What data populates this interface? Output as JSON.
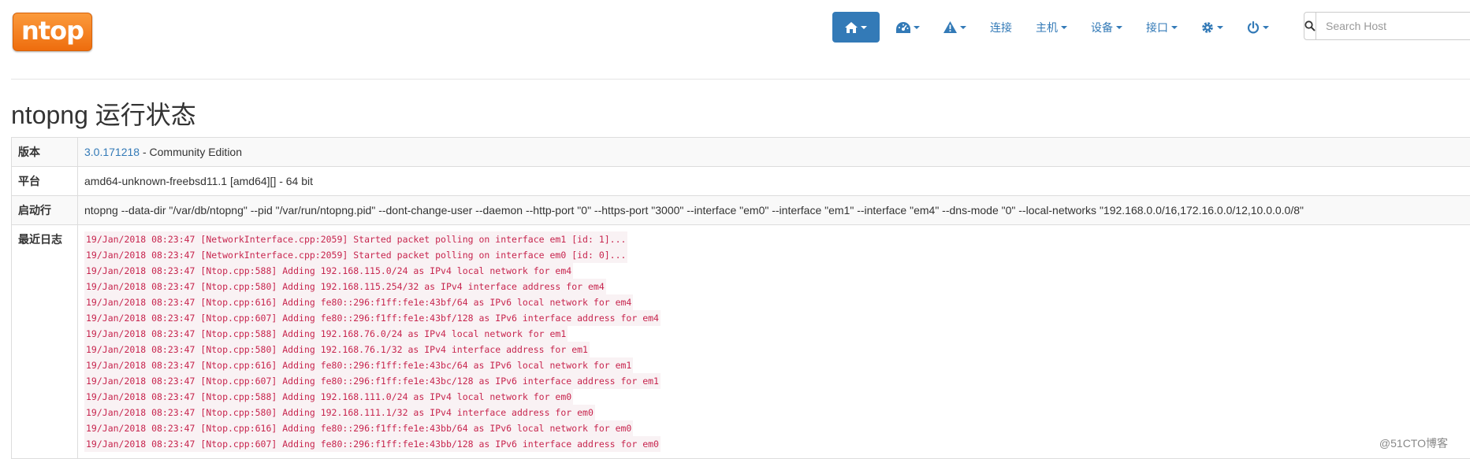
{
  "logo": {
    "text": "ntop"
  },
  "nav": {
    "links": [
      "连接",
      "主机",
      "设备",
      "接口"
    ]
  },
  "search": {
    "placeholder": "Search Host"
  },
  "page": {
    "title": "ntopng 运行状态"
  },
  "status": {
    "version_label": "版本",
    "version_link": "3.0.171218",
    "version_suffix": " - Community Edition",
    "platform_label": "平台",
    "platform_value": "amd64-unknown-freebsd11.1 [amd64][] - 64 bit",
    "startup_label": "启动行",
    "startup_value": "ntopng --data-dir \"/var/db/ntopng\" --pid \"/var/run/ntopng.pid\" --dont-change-user --daemon --http-port \"0\" --https-port \"3000\" --interface \"em0\" --interface \"em1\" --interface \"em4\" --dns-mode \"0\" --local-networks \"192.168.0.0/16,172.16.0.0/12,10.0.0.0/8\"",
    "log_label": "最近日志",
    "log_lines": [
      "19/Jan/2018 08:23:47 [NetworkInterface.cpp:2059] Started packet polling on interface em1 [id: 1]...",
      "19/Jan/2018 08:23:47 [NetworkInterface.cpp:2059] Started packet polling on interface em0 [id: 0]...",
      "19/Jan/2018 08:23:47 [Ntop.cpp:588] Adding 192.168.115.0/24 as IPv4 local network for em4",
      "19/Jan/2018 08:23:47 [Ntop.cpp:580] Adding 192.168.115.254/32 as IPv4 interface address for em4",
      "19/Jan/2018 08:23:47 [Ntop.cpp:616] Adding fe80::296:f1ff:fe1e:43bf/64 as IPv6 local network for em4",
      "19/Jan/2018 08:23:47 [Ntop.cpp:607] Adding fe80::296:f1ff:fe1e:43bf/128 as IPv6 interface address for em4",
      "19/Jan/2018 08:23:47 [Ntop.cpp:588] Adding 192.168.76.0/24 as IPv4 local network for em1",
      "19/Jan/2018 08:23:47 [Ntop.cpp:580] Adding 192.168.76.1/32 as IPv4 interface address for em1",
      "19/Jan/2018 08:23:47 [Ntop.cpp:616] Adding fe80::296:f1ff:fe1e:43bc/64 as IPv6 local network for em1",
      "19/Jan/2018 08:23:47 [Ntop.cpp:607] Adding fe80::296:f1ff:fe1e:43bc/128 as IPv6 interface address for em1",
      "19/Jan/2018 08:23:47 [Ntop.cpp:588] Adding 192.168.111.0/24 as IPv4 local network for em0",
      "19/Jan/2018 08:23:47 [Ntop.cpp:580] Adding 192.168.111.1/32 as IPv4 interface address for em0",
      "19/Jan/2018 08:23:47 [Ntop.cpp:616] Adding fe80::296:f1ff:fe1e:43bb/64 as IPv6 local network for em0",
      "19/Jan/2018 08:23:47 [Ntop.cpp:607] Adding fe80::296:f1ff:fe1e:43bb/128 as IPv6 interface address for em0"
    ]
  },
  "watermark": "@51CTO博客",
  "colors": {
    "accent": "#337ab7",
    "logo": "#f07a1c",
    "code_text": "#c7254e",
    "code_bg": "#f9f2f4"
  }
}
